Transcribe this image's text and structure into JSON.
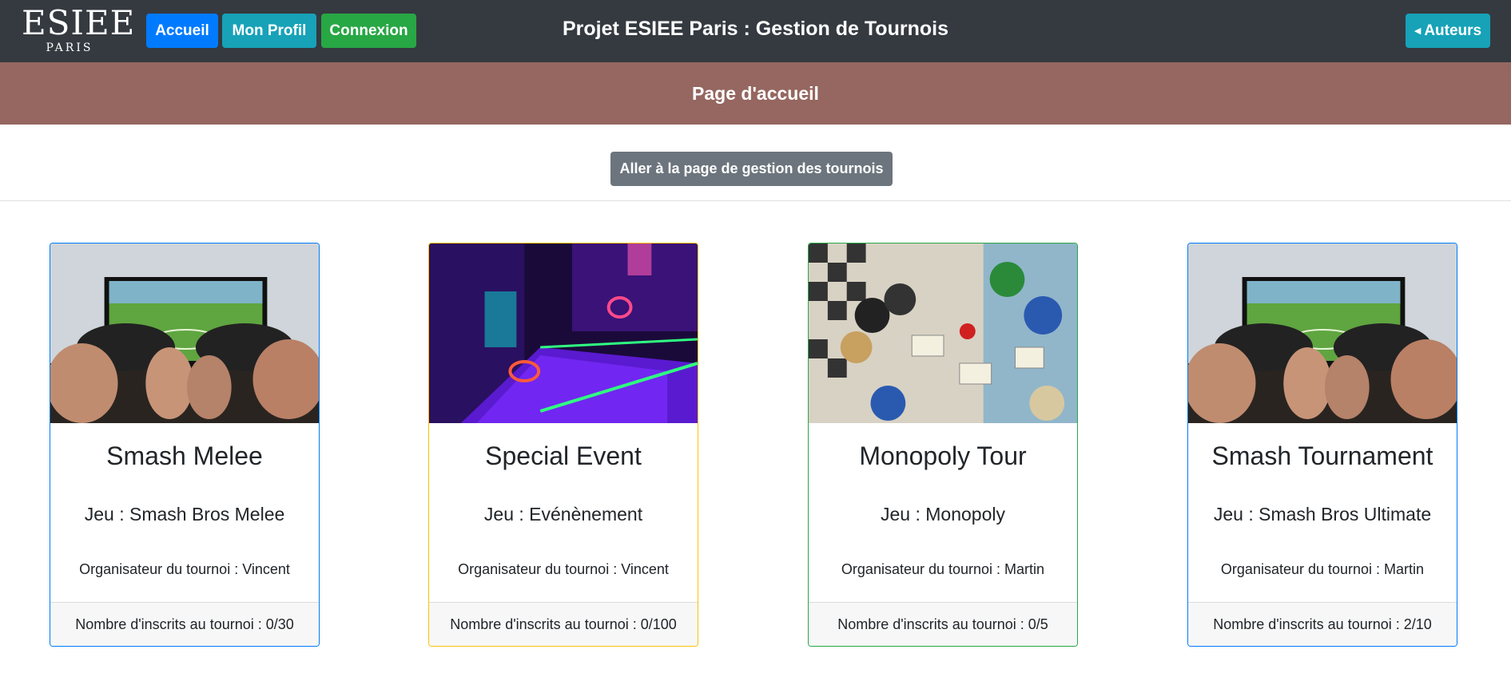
{
  "navbar": {
    "logo_main": "ESIEE",
    "logo_sub": "PARIS",
    "accueil_label": "Accueil",
    "profil_label": "Mon Profil",
    "connexion_label": "Connexion",
    "title": "Projet ESIEE Paris : Gestion de Tournois",
    "auteurs_label": "Auteurs",
    "colors": {
      "bg": "#343a40",
      "accueil": "#007bff",
      "profil": "#17a2b8",
      "connexion": "#28a745",
      "auteurs": "#17a2b8"
    }
  },
  "banner": {
    "title": "Page d'accueil",
    "color": "#956760"
  },
  "gestion_button": {
    "label": "Aller à la page de gestion des tournois",
    "color": "#6c757d"
  },
  "tournaments": [
    {
      "name": "Smash Melee",
      "game": "Jeu : Smash Bros Melee",
      "organizer": "Organisateur du tournoi : Vincent",
      "registrations": "Nombre d'inscrits au tournoi : 0/30",
      "image": "gaming-controllers-image",
      "border_color": "#007bff"
    },
    {
      "name": "Special Event",
      "game": "Jeu : Evénènement",
      "organizer": "Organisateur du tournoi : Vincent",
      "registrations": "Nombre d'inscrits au tournoi : 0/100",
      "image": "neon-arcade-image",
      "border_color": "#ffc107"
    },
    {
      "name": "Monopoly Tour",
      "game": "Jeu : Monopoly",
      "organizer": "Organisateur du tournoi : Martin",
      "registrations": "Nombre d'inscrits au tournoi : 0/5",
      "image": "board-games-image",
      "border_color": "#28a745"
    },
    {
      "name": "Smash Tournament",
      "game": "Jeu : Smash Bros Ultimate",
      "organizer": "Organisateur du tournoi : Martin",
      "registrations": "Nombre d'inscrits au tournoi : 2/10",
      "image": "gaming-controllers-image",
      "border_color": "#007bff"
    }
  ]
}
